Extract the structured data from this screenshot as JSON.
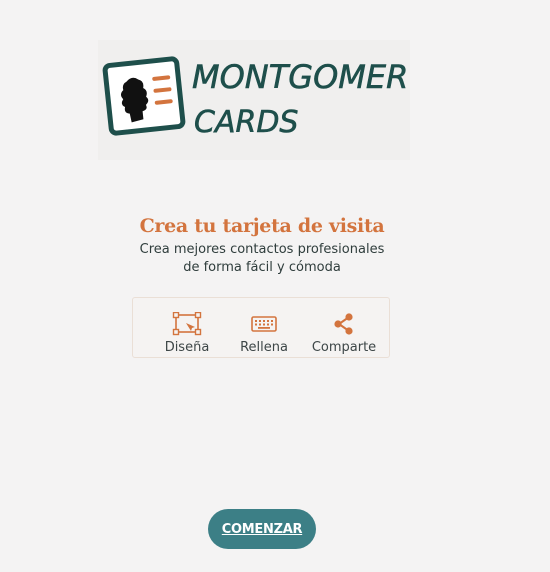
{
  "logo": {
    "brand_line1": "MONTGOMERY",
    "brand_line2": "CARDS",
    "colors": {
      "dark": "#1e4f4b",
      "accent": "#d3743e"
    }
  },
  "hero": {
    "title": "Crea tu tarjeta de visita",
    "subtitle": "Crea mejores contactos profesionales de forma fácil y cómoda"
  },
  "features": [
    {
      "icon": "design-frame-icon",
      "label": "Diseña"
    },
    {
      "icon": "keyboard-icon",
      "label": "Rellena"
    },
    {
      "icon": "share-icon",
      "label": "Comparte"
    }
  ],
  "cta": {
    "label": "COMENZAR"
  },
  "colors": {
    "background": "#f4f3f3",
    "accent": "#d3743e",
    "button": "#3c7f86",
    "text": "#2f3d3c"
  }
}
